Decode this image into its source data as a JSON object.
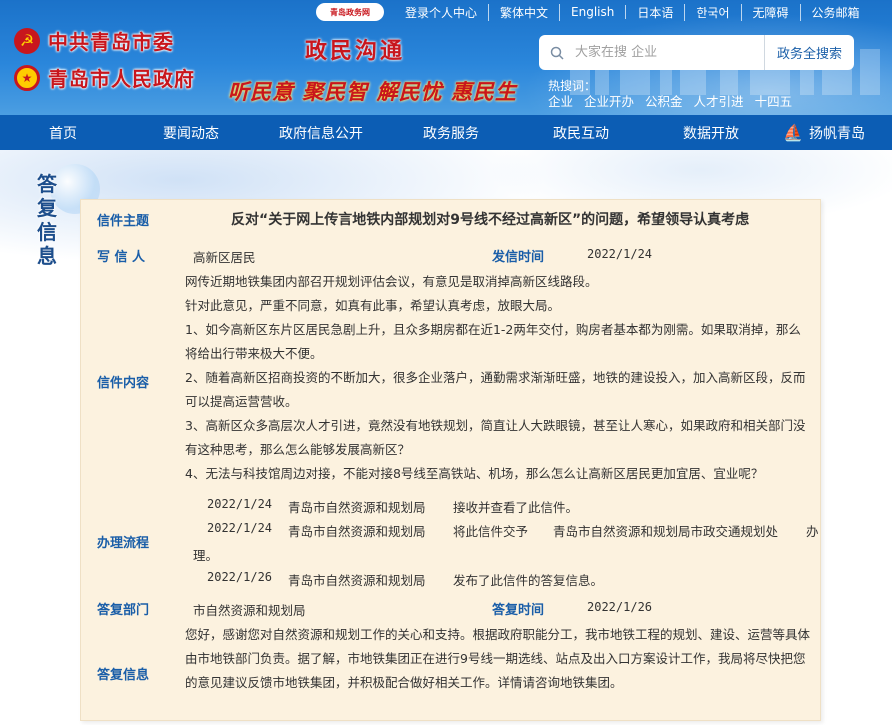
{
  "header": {
    "logo_badge": "青岛政务网",
    "top_links": [
      "登录个人中心",
      "繁体中文",
      "English",
      "日本语",
      "한국어",
      "无障碍",
      "公务邮箱"
    ],
    "party_name": "中共青岛市委",
    "gov_name": "青岛市人民政府",
    "section_title": "政民沟通",
    "slogan": "听民意 聚民智 解民忧 惠民生",
    "search": {
      "placeholder": "大家在搜 企业",
      "button": "政务全搜索"
    },
    "hot_label": "热搜词：",
    "hot_words": [
      "企业",
      "企业开办",
      "公积金",
      "人才引进",
      "十四五"
    ]
  },
  "nav": {
    "items": [
      "首页",
      "要闻动态",
      "政府信息公开",
      "政务服务",
      "政民互动",
      "数据开放"
    ],
    "brand": "扬帆青岛"
  },
  "side_title": "答复信息",
  "letter": {
    "subject_label": "信件主题",
    "subject": "反对“关于网上传言地铁内部规划对9号线不经过高新区”的问题，希望领导认真考虑",
    "writer_label": "写 信 人",
    "writer": "高新区居民",
    "sent_label": "发信时间",
    "sent_time": "2022/1/24",
    "content_label": "信件内容",
    "content": [
      "网传近期地铁集团内部召开规划评估会议，有意见是取消掉高新区线路段。",
      "针对此意见，严重不同意，如真有此事，希望认真考虑，放眼大局。",
      "1、如今高新区东片区居民急剧上升，且众多期房都在近1-2两年交付，购房者基本都为刚需。如果取消掉，那么将给出行带来极大不便。",
      "2、随着高新区招商投资的不断加大，很多企业落户，通勤需求渐渐旺盛，地铁的建设投入，加入高新区段，反而可以提高运营营收。",
      "3、高新区众多高层次人才引进，竟然没有地铁规划，简直让人大跌眼镜，甚至让人寒心，如果政府和相关部门没有这种思考，那么怎么能够发展高新区？",
      "4、无法与科技馆周边对接，不能对接8号线至高铁站、机场，那么怎么让高新区居民更加宜居、宜业呢？"
    ],
    "process_label": "办理流程",
    "process": [
      {
        "date": "2022/1/24",
        "org": "青岛市自然资源和规划局",
        "action": "接收并查看了此信件。"
      },
      {
        "date": "2022/1/24",
        "org": "青岛市自然资源和规划局",
        "action": "将此信件交予",
        "target": "青岛市自然资源和规划局市政交通规划处",
        "tail": "办",
        "tail2": "理。"
      },
      {
        "date": "2022/1/26",
        "org": "青岛市自然资源和规划局",
        "action": "发布了此信件的答复信息。"
      }
    ],
    "reply_dept_label": "答复部门",
    "reply_dept": "市自然资源和规划局",
    "reply_time_label": "答复时间",
    "reply_time": "2022/1/26",
    "reply_label": "答复信息",
    "reply": "您好，感谢您对自然资源和规划工作的关心和支持。根据政府职能分工，我市地铁工程的规划、建设、运营等具体由市地铁部门负责。据了解，市地铁集团正在进行9号线一期选线、站点及出入口方案设计工作，我局将尽快把您的意见建议反馈市地铁集团，并积极配合做好相关工作。详情请咨询地铁集团。"
  }
}
